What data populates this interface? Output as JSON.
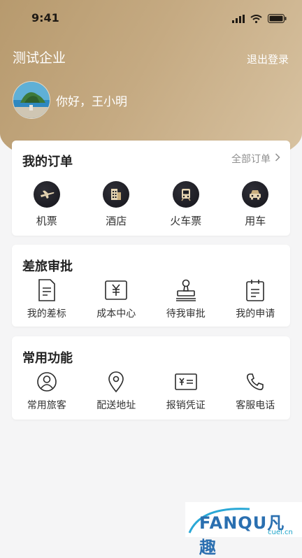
{
  "status_bar": {
    "time": "9:41"
  },
  "header": {
    "company": "测试企业",
    "logout_label": "退出登录",
    "greeting": "你好，王小明"
  },
  "orders": {
    "title": "我的订单",
    "all_label": "全部订单",
    "items": [
      {
        "label": "机票",
        "icon": "airplane-icon"
      },
      {
        "label": "酒店",
        "icon": "hotel-icon"
      },
      {
        "label": "火车票",
        "icon": "train-icon"
      },
      {
        "label": "用车",
        "icon": "car-icon"
      }
    ]
  },
  "approval": {
    "title": "差旅审批",
    "items": [
      {
        "label": "我的差标",
        "icon": "document-icon"
      },
      {
        "label": "成本中心",
        "icon": "yuan-icon"
      },
      {
        "label": "待我审批",
        "icon": "stamp-icon"
      },
      {
        "label": "我的申请",
        "icon": "clipboard-icon"
      }
    ]
  },
  "functions": {
    "title": "常用功能",
    "items": [
      {
        "label": "常用旅客",
        "icon": "person-icon"
      },
      {
        "label": "配送地址",
        "icon": "location-pin-icon"
      },
      {
        "label": "报销凭证",
        "icon": "receipt-icon"
      },
      {
        "label": "客服电话",
        "icon": "phone-icon"
      }
    ]
  },
  "watermark": {
    "brand": "FANQU凡趣",
    "domain": "cuel.cn"
  },
  "colors": {
    "header_gold": "#c5aa82",
    "icon_circle": "#1b1b21",
    "icon_accent": "#c9ae7e"
  }
}
